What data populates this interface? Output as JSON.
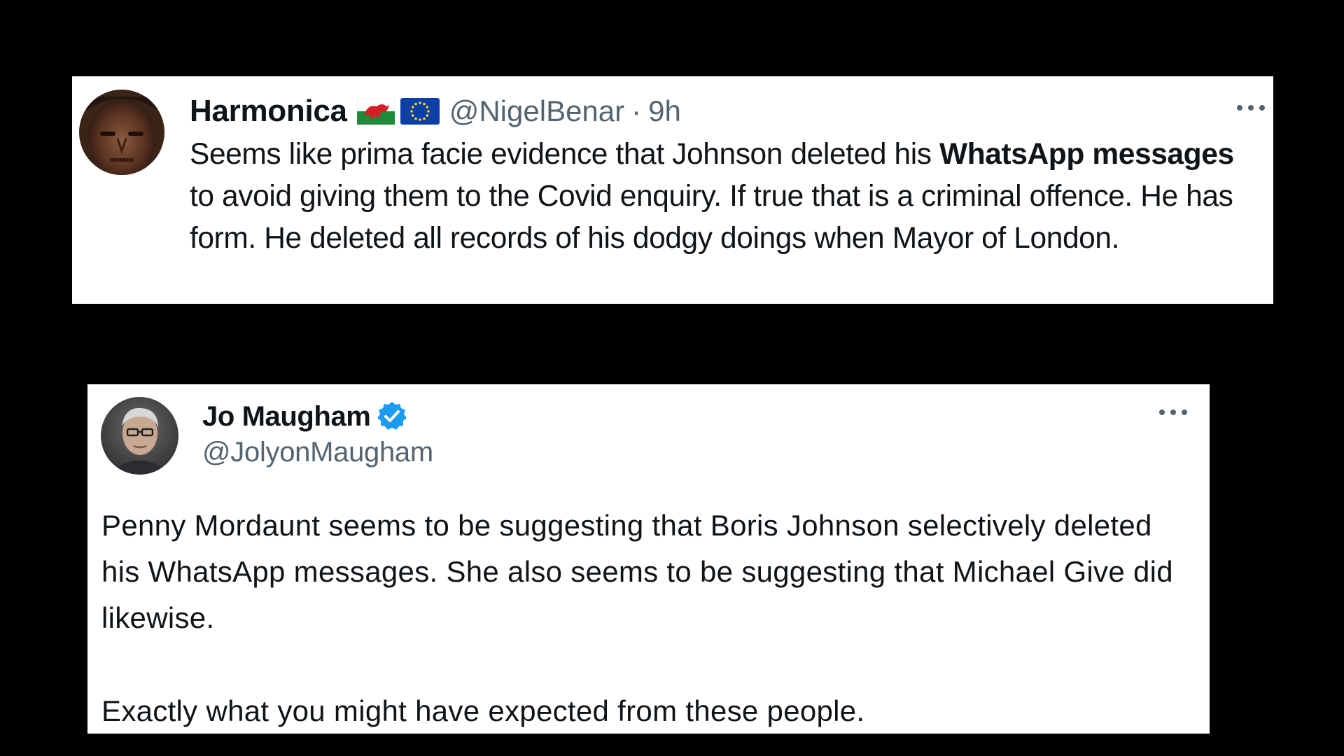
{
  "tweet1": {
    "display_name": "Harmonica",
    "flags": [
      "welsh-flag-icon",
      "eu-flag-icon"
    ],
    "handle": "@NigelBenar",
    "separator": "·",
    "time": "9h",
    "more_icon": "more-horizontal-icon",
    "text_before": "Seems like prima facie evidence that Johnson deleted his ",
    "text_bold": "WhatsApp messages",
    "text_after": " to avoid giving them to the Covid enquiry.   If true that is a criminal offence. He has form. He deleted all records of his dodgy doings when Mayor of London."
  },
  "tweet2": {
    "display_name": "Jo Maugham",
    "verified_icon": "verified-badge-icon",
    "handle": "@JolyonMaugham",
    "more_icon": "more-horizontal-icon",
    "paragraph1": "Penny Mordaunt seems to be suggesting that Boris Johnson selectively deleted his WhatsApp messages. She also seems to be suggesting that Michael Give did likewise.",
    "paragraph2": "Exactly what you might have expected from these people."
  },
  "colors": {
    "background": "#000000",
    "card": "#ffffff",
    "text": "#0f1419",
    "secondary": "#536471",
    "verified": "#1d9bf0"
  }
}
